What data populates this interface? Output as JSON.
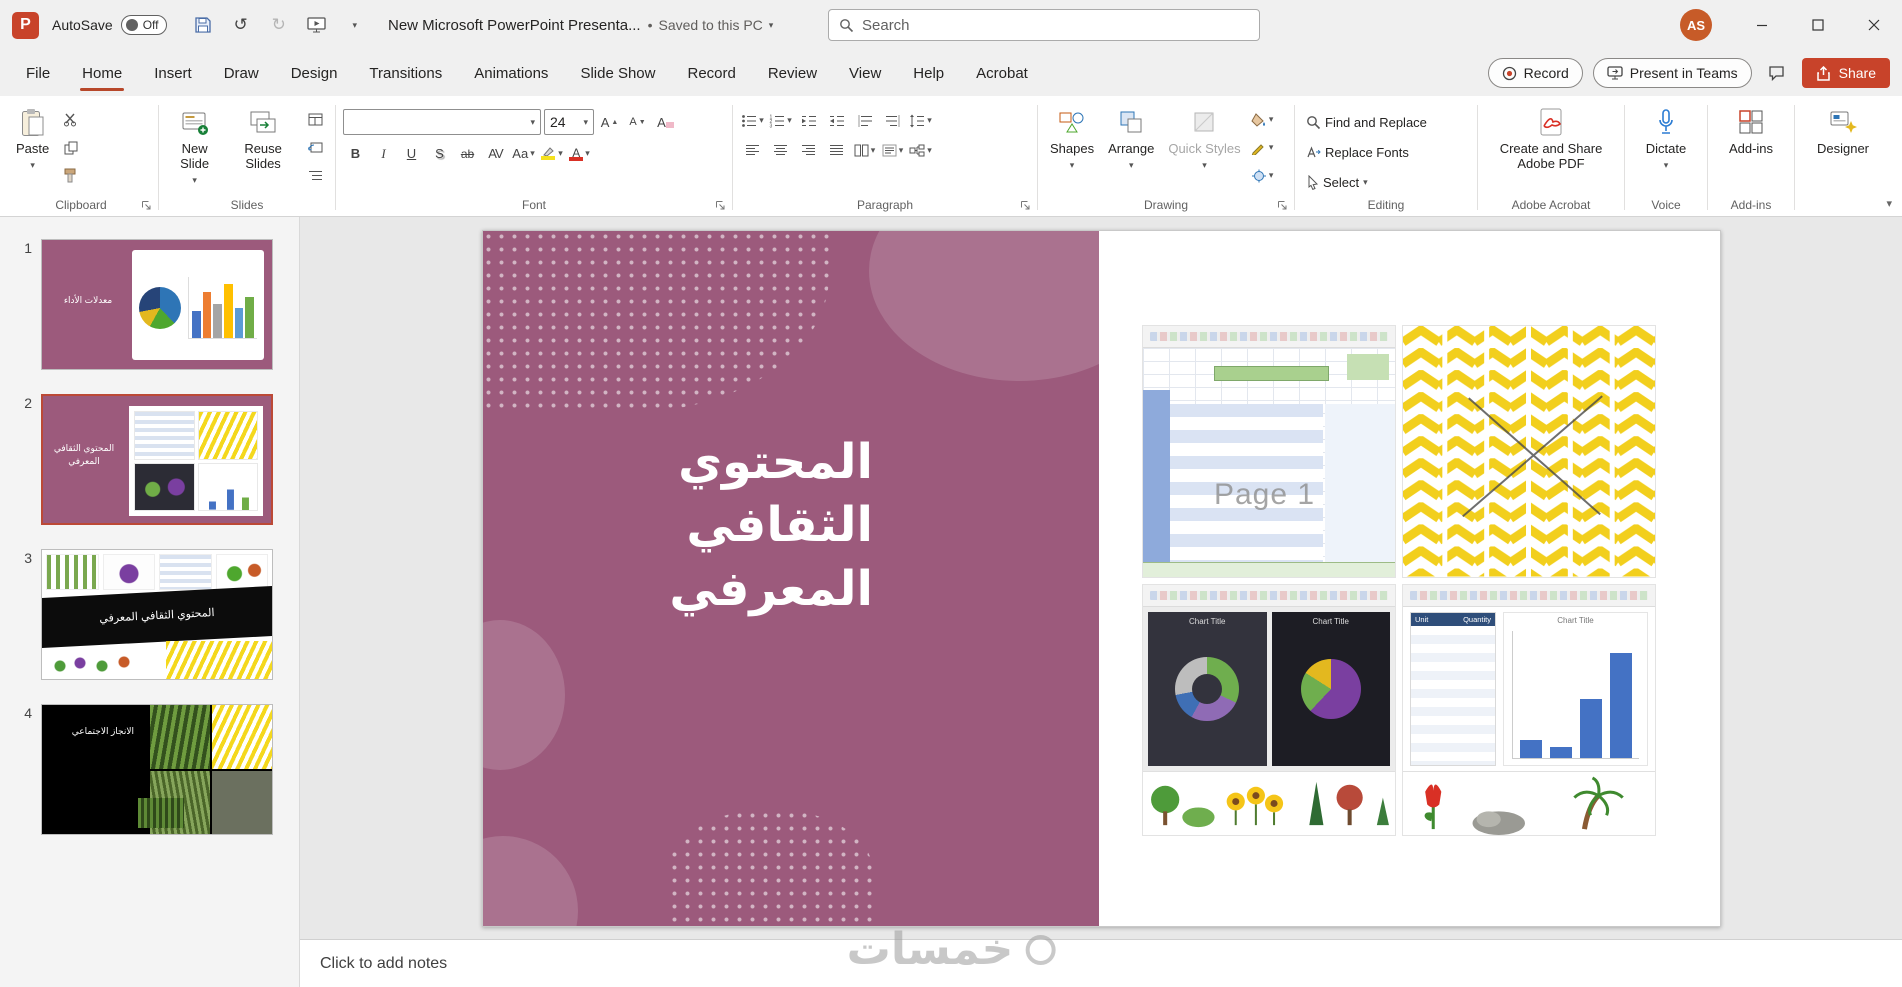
{
  "titlebar": {
    "autosave_label": "AutoSave",
    "autosave_state": "Off",
    "doc_title": "New Microsoft PowerPoint Presenta...",
    "saved_separator": "•",
    "saved_status": "Saved to this PC",
    "search_placeholder": "Search",
    "avatar_initials": "AS"
  },
  "tabs": {
    "items": [
      {
        "label": "File"
      },
      {
        "label": "Home"
      },
      {
        "label": "Insert"
      },
      {
        "label": "Draw"
      },
      {
        "label": "Design"
      },
      {
        "label": "Transitions"
      },
      {
        "label": "Animations"
      },
      {
        "label": "Slide Show"
      },
      {
        "label": "Record"
      },
      {
        "label": "Review"
      },
      {
        "label": "View"
      },
      {
        "label": "Help"
      },
      {
        "label": "Acrobat"
      }
    ]
  },
  "quick_actions": {
    "record": "Record",
    "present_in_teams": "Present in Teams",
    "share": "Share"
  },
  "ribbon": {
    "clipboard": {
      "group_label": "Clipboard",
      "paste": "Paste"
    },
    "slides": {
      "group_label": "Slides",
      "new_slide": "New Slide",
      "reuse_slides": "Reuse Slides"
    },
    "font": {
      "group_label": "Font",
      "font_name": "",
      "font_size": "24",
      "bold": "B",
      "italic": "I",
      "underline": "U",
      "shadow": "S",
      "strike": "ab",
      "spacing": "AV",
      "change_case": "Aa",
      "grow": "A",
      "shrink": "A",
      "clear": "A",
      "color": "A"
    },
    "paragraph": {
      "group_label": "Paragraph"
    },
    "drawing": {
      "group_label": "Drawing",
      "shapes": "Shapes",
      "arrange": "Arrange",
      "quick_styles": "Quick Styles"
    },
    "editing": {
      "group_label": "Editing",
      "find_replace": "Find and Replace",
      "replace_fonts": "Replace Fonts",
      "select": "Select"
    },
    "acrobat": {
      "group_label": "Adobe Acrobat",
      "create_share": "Create and Share Adobe PDF"
    },
    "voice": {
      "group_label": "Voice",
      "dictate": "Dictate"
    },
    "addins": {
      "group_label": "Add-ins",
      "button": "Add-ins"
    },
    "designer": {
      "button": "Designer"
    }
  },
  "slide_panel": {
    "slides": [
      {
        "number": "1",
        "title": "معدلات الأداء"
      },
      {
        "number": "2",
        "title": "المحتوي الثقافي المعرفي"
      },
      {
        "number": "3",
        "title": "المحتوي الثقافي المعرفي"
      },
      {
        "number": "4",
        "title": "الانجاز الاجتماعي"
      }
    ]
  },
  "slide": {
    "title_line1": "المحتوي الثقافي",
    "title_line2": "المعرفي",
    "page_watermark": "Page 1",
    "chart_title": "Chart Title",
    "table_header_unit": "Unit",
    "table_header_quantity": "Quantity"
  },
  "notes": {
    "placeholder": "Click to add notes"
  },
  "watermark": {
    "text": "خمسات"
  },
  "colors": {
    "accent": "#c8432a",
    "slide_purple": "#9c5a7c",
    "selection": "#bc4936"
  }
}
